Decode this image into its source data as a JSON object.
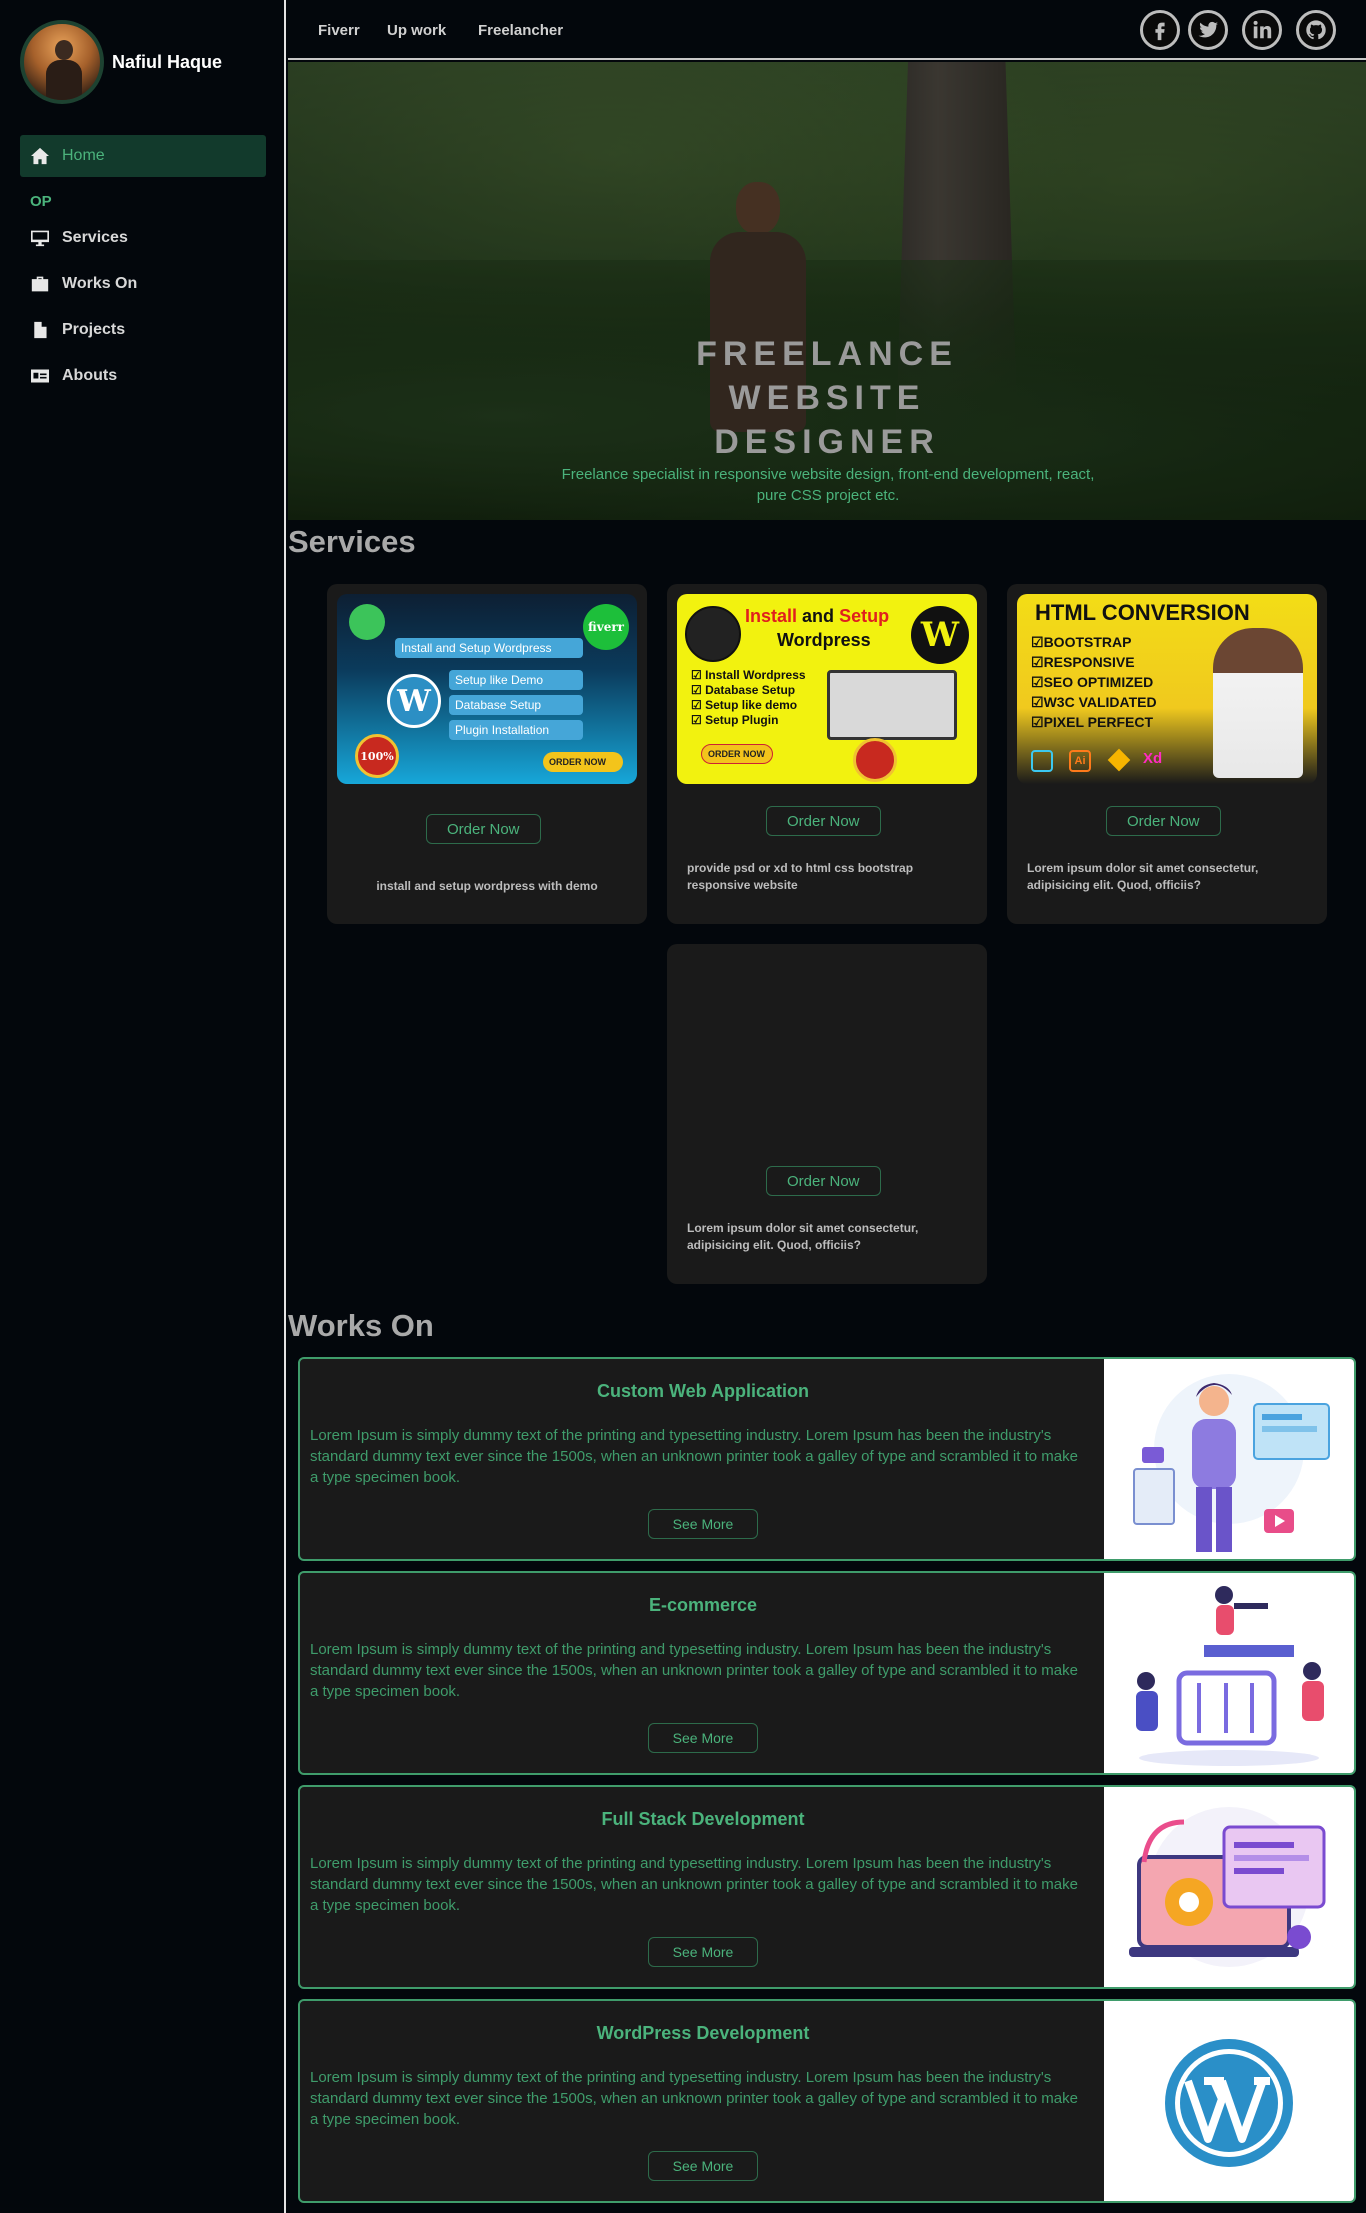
{
  "profile": {
    "name": "Nafiul Haque"
  },
  "sidebar": {
    "section_label": "OP",
    "items": [
      {
        "label": "Home",
        "icon": "home-icon"
      },
      {
        "label": "Services",
        "icon": "desktop-icon"
      },
      {
        "label": "Works On",
        "icon": "briefcase-icon"
      },
      {
        "label": "Projects",
        "icon": "file-icon"
      },
      {
        "label": "Abouts",
        "icon": "id-card-icon"
      }
    ]
  },
  "topbar": {
    "links": [
      "Fiverr",
      "Up work",
      "Freelancher"
    ],
    "socials": [
      "facebook-icon",
      "twitter-icon",
      "linkedin-icon",
      "github-icon"
    ]
  },
  "hero": {
    "title_line1": "FREELANCE",
    "title_line2": "WEBSITE",
    "title_line3": "DESIGNER",
    "subtitle": "Freelance specialist in responsive website design, front-end development, react, pure CSS project etc."
  },
  "services": {
    "heading": "Services",
    "cards": [
      {
        "button": "Order Now",
        "description": "install and setup wordpress with demo",
        "image": {
          "banner": "Install and Setup Wordpress",
          "badge": "fiverr",
          "items": [
            "Setup like Demo",
            "Database Setup",
            "Plugin Installation"
          ],
          "cta": "ORDER NOW",
          "seal": "100%"
        }
      },
      {
        "button": "Order Now",
        "description": "provide psd or xd to html css bootstrap responsive website",
        "image": {
          "title_red": "Install",
          "title_and": "and",
          "title_setup": "Setup",
          "title_line2": "Wordpress",
          "items": [
            "Install Wordpress",
            "Database Setup",
            "Setup like demo",
            "Setup Plugin"
          ],
          "cta": "ORDER NOW"
        }
      },
      {
        "button": "Order Now",
        "description": "Lorem ipsum dolor sit amet consectetur, adipisicing elit. Quod, officiis?",
        "image": {
          "title": "HTML CONVERSION",
          "items": [
            "BOOTSTRAP",
            "RESPONSIVE",
            "SEO OPTIMIZED",
            "W3C VALIDATED",
            "PIXEL PERFECT"
          ],
          "tools": [
            "Ai",
            "Xd"
          ]
        }
      },
      {
        "button": "Order Now",
        "description": "Lorem ipsum dolor sit amet consectetur, adipisicing elit. Quod, officiis?"
      }
    ]
  },
  "works": {
    "heading": "Works On",
    "cards": [
      {
        "title": "Custom Web Application",
        "text": "Lorem Ipsum is simply dummy text of the printing and typesetting industry. Lorem Ipsum has been the industry's standard dummy text ever since the 1500s, when an unknown printer took a galley of type and scrambled it to make a type specimen book.",
        "button": "See More"
      },
      {
        "title": "E-commerce",
        "text": "Lorem Ipsum is simply dummy text of the printing and typesetting industry. Lorem Ipsum has been the industry's standard dummy text ever since the 1500s, when an unknown printer took a galley of type and scrambled it to make a type specimen book.",
        "button": "See More"
      },
      {
        "title": "Full Stack Development",
        "text": "Lorem Ipsum is simply dummy text of the printing and typesetting industry. Lorem Ipsum has been the industry's standard dummy text ever since the 1500s, when an unknown printer took a galley of type and scrambled it to make a type specimen book.",
        "button": "See More"
      },
      {
        "title": "WordPress Development",
        "text": "Lorem Ipsum is simply dummy text of the printing and typesetting industry. Lorem Ipsum has been the industry's standard dummy text ever since the 1500s, when an unknown printer took a galley of type and scrambled it to make a type specimen book.",
        "button": "See More"
      }
    ]
  },
  "colors": {
    "accent": "#4bb37c",
    "background": "#03070c",
    "card": "#1a1a1a",
    "active_nav": "#123a2c"
  }
}
